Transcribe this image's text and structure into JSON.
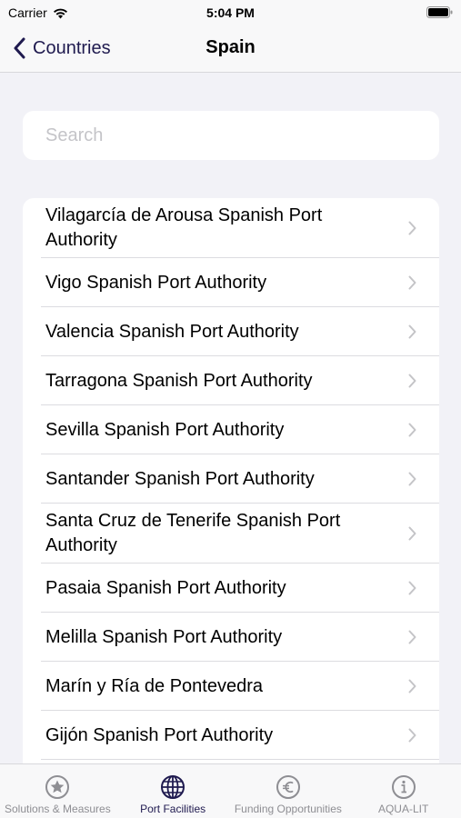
{
  "status_bar": {
    "carrier": "Carrier",
    "time": "5:04 PM"
  },
  "nav": {
    "back_label": "Countries",
    "title": "Spain"
  },
  "search": {
    "placeholder": "Search",
    "value": ""
  },
  "list": {
    "items": [
      {
        "label": "Vilagarcía de Arousa Spanish Port Authority"
      },
      {
        "label": "Vigo Spanish Port Authority"
      },
      {
        "label": "Valencia Spanish Port Authority"
      },
      {
        "label": "Tarragona Spanish Port Authority"
      },
      {
        "label": "Sevilla Spanish Port Authority"
      },
      {
        "label": "Santander Spanish Port Authority"
      },
      {
        "label": "Santa Cruz de Tenerife Spanish Port Authority"
      },
      {
        "label": "Pasaia Spanish Port Authority"
      },
      {
        "label": "Melilla Spanish Port Authority"
      },
      {
        "label": "Marín y Ría de Pontevedra"
      },
      {
        "label": "Gijón Spanish Port Authority"
      }
    ]
  },
  "tab_bar": {
    "tabs": [
      {
        "label": "Solutions & Measures",
        "icon": "star-circle-icon",
        "active": false
      },
      {
        "label": "Port Facilities",
        "icon": "globe-icon",
        "active": true
      },
      {
        "label": "Funding Opportunities",
        "icon": "euro-circle-icon",
        "active": false
      },
      {
        "label": "AQUA-LIT",
        "icon": "info-circle-icon",
        "active": false
      }
    ]
  },
  "colors": {
    "accent": "#1f1a4f",
    "background": "#f2f2f7",
    "inactive_tab": "#8e8e93"
  }
}
